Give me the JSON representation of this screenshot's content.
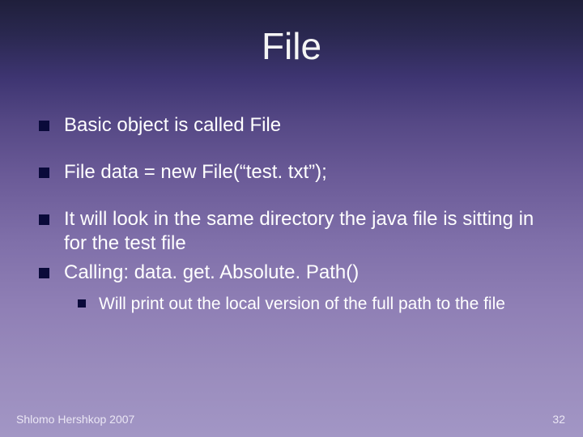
{
  "slide": {
    "title": "File",
    "bullets": [
      {
        "text": "Basic object is called File"
      },
      {
        "text": "File data = new File(“test. txt”);"
      },
      {
        "text": "It will look in the same directory the java file is sitting in for the test file"
      },
      {
        "text": "Calling: data. get. Absolute. Path()"
      }
    ],
    "subbullets": [
      {
        "text": "Will print out the local version of the full path to the file"
      }
    ],
    "footer_left": "Shlomo Hershkop 2007",
    "footer_right": "32"
  }
}
